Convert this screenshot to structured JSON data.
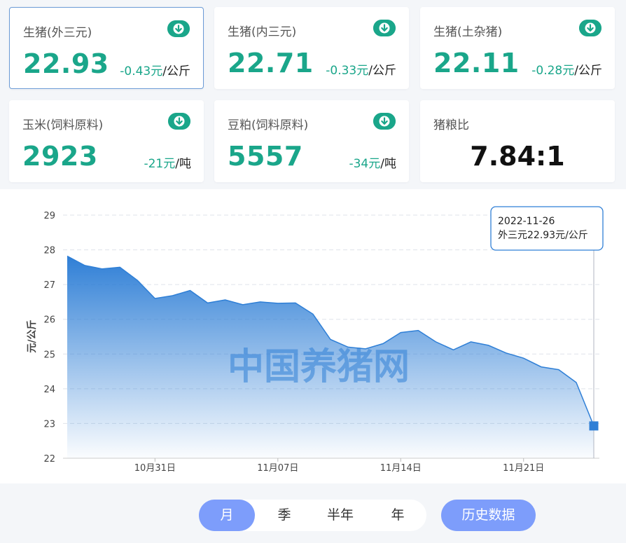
{
  "cards": [
    {
      "label": "生猪(外三元)",
      "value": "22.93",
      "change": "-0.43元",
      "unit": "/公斤"
    },
    {
      "label": "生猪(内三元)",
      "value": "22.71",
      "change": "-0.33元",
      "unit": "/公斤"
    },
    {
      "label": "生猪(土杂猪)",
      "value": "22.11",
      "change": "-0.28元",
      "unit": "/公斤"
    },
    {
      "label": "玉米(饲料原料)",
      "value": "2923",
      "change": "-21元",
      "unit": "/吨"
    },
    {
      "label": "豆粕(饲料原料)",
      "value": "5557",
      "change": "-34元",
      "unit": "/吨"
    },
    {
      "label": "猪粮比",
      "value": "7.84:1"
    }
  ],
  "colors": {
    "accent_green": "#1aa68a",
    "series_blue": "#2f7fd6",
    "button_blue": "#7d9dfb"
  },
  "chart_data": {
    "type": "area",
    "ylabel": "元/公斤",
    "ylim": [
      22,
      29
    ],
    "yticks": [
      "22",
      "23",
      "24",
      "25",
      "26",
      "27",
      "28",
      "29"
    ],
    "xticks": [
      {
        "label": "10月31日",
        "day": 5
      },
      {
        "label": "11月07日",
        "day": 12
      },
      {
        "label": "11月14日",
        "day": 19
      },
      {
        "label": "11月21日",
        "day": 26
      }
    ],
    "grid": true,
    "watermark": "中国养猪网",
    "tooltip": {
      "date": "2022-11-26",
      "text": "外三元22.93元/公斤"
    },
    "x": [
      "2022-10-27",
      "2022-10-28",
      "2022-10-29",
      "2022-10-30",
      "2022-10-31",
      "2022-11-01",
      "2022-11-02",
      "2022-11-03",
      "2022-11-04",
      "2022-11-05",
      "2022-11-06",
      "2022-11-07",
      "2022-11-08",
      "2022-11-09",
      "2022-11-10",
      "2022-11-11",
      "2022-11-12",
      "2022-11-13",
      "2022-11-14",
      "2022-11-15",
      "2022-11-16",
      "2022-11-17",
      "2022-11-18",
      "2022-11-19",
      "2022-11-20",
      "2022-11-21",
      "2022-11-22",
      "2022-11-23",
      "2022-11-24",
      "2022-11-25",
      "2022-11-26"
    ],
    "series": [
      {
        "values": [
          27.82,
          27.55,
          27.45,
          27.5,
          27.12,
          26.6,
          26.68,
          26.83,
          26.47,
          26.56,
          26.42,
          26.5,
          26.46,
          26.47,
          26.15,
          25.42,
          25.2,
          25.15,
          25.3,
          25.62,
          25.68,
          25.35,
          25.12,
          25.35,
          25.25,
          25.03,
          24.88,
          24.63,
          24.55,
          24.18,
          22.93
        ]
      }
    ]
  },
  "period_buttons": [
    "月",
    "季",
    "半年",
    "年"
  ],
  "active_period": "月",
  "history_label": "历史数据"
}
